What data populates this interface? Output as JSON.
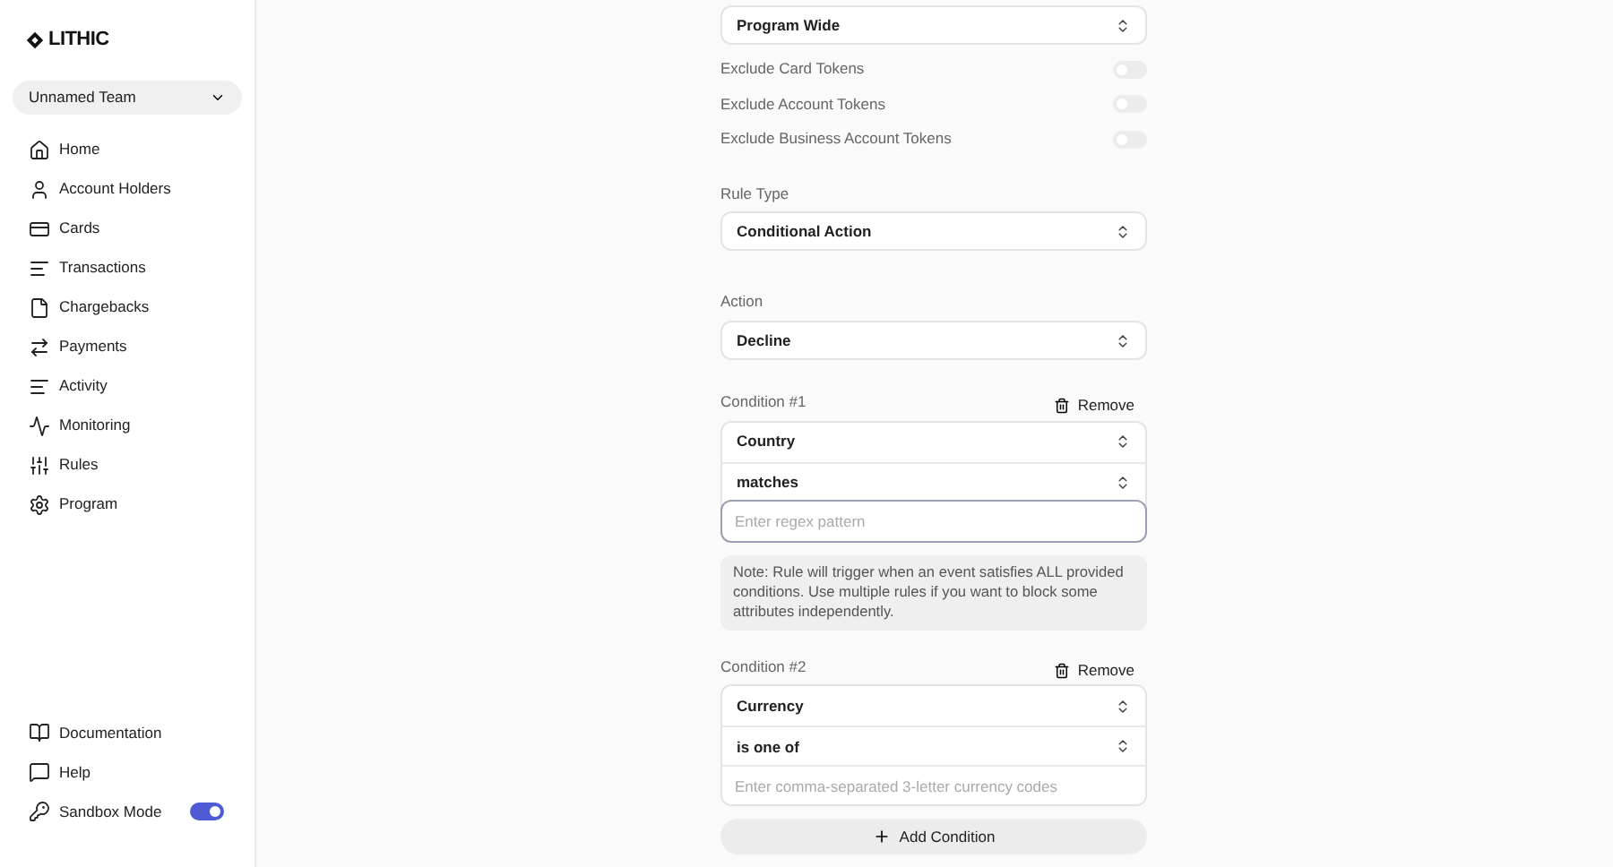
{
  "sidebar": {
    "logo": "LITHIC",
    "team": "Unnamed Team",
    "nav": [
      {
        "label": "Home",
        "selected": false
      },
      {
        "label": "Account Holders",
        "selected": false
      },
      {
        "label": "Cards",
        "selected": false
      },
      {
        "label": "Transactions",
        "selected": false
      },
      {
        "label": "Chargebacks",
        "selected": false
      },
      {
        "label": "Payments",
        "selected": false
      },
      {
        "label": "Activity",
        "selected": false
      },
      {
        "label": "Monitoring",
        "selected": false
      },
      {
        "label": "Rules",
        "selected": false
      },
      {
        "label": "Program",
        "selected": false
      }
    ],
    "footer": [
      {
        "kind": "link",
        "label": "Documentation"
      },
      {
        "kind": "link",
        "label": "Help"
      },
      {
        "kind": "toggle",
        "label": "Sandbox Mode",
        "on": true
      }
    ]
  },
  "form": {
    "scope": "Program Wide",
    "toggles": [
      {
        "label": "Exclude Card Tokens",
        "on": false
      },
      {
        "label": "Exclude Account Tokens",
        "on": false
      },
      {
        "label": "Exclude Business Account Tokens",
        "on": false
      }
    ],
    "rule_type": {
      "label": "Rule Type",
      "value": "Conditional Action"
    },
    "action": {
      "label": "Action",
      "value": "Decline"
    },
    "conditions": [
      {
        "title": "Condition #1",
        "remove": "Remove",
        "rows": [
          {
            "kind": "select",
            "value": "Country"
          },
          {
            "kind": "select",
            "value": "matches"
          },
          {
            "kind": "input",
            "placeholder": "Enter regex pattern",
            "focused": true
          }
        ],
        "note": "Note: Rule will trigger when an event satisfies ALL provided conditions. Use multiple rules if you want to block some attributes independently."
      },
      {
        "title": "Condition #2",
        "remove": "Remove",
        "rows": [
          {
            "kind": "select",
            "value": "Currency"
          },
          {
            "kind": "select",
            "value": "is one of"
          },
          {
            "kind": "input",
            "placeholder": "Enter comma-separated 3-letter currency codes",
            "focused": false
          }
        ]
      }
    ],
    "add_button": "Add Condition"
  }
}
